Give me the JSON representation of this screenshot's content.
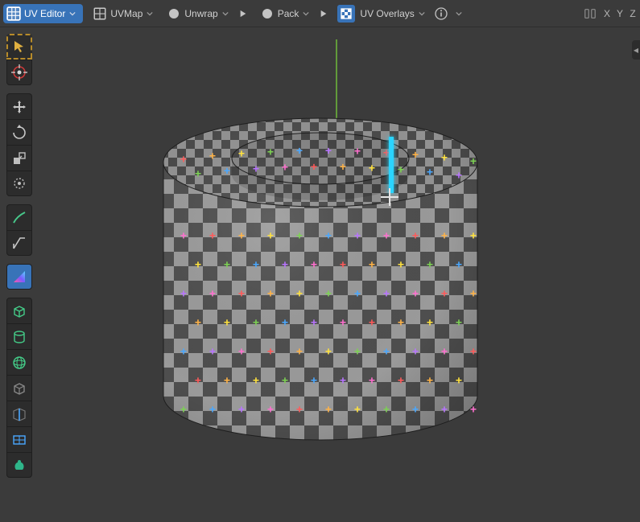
{
  "header": {
    "editor_label": "UV Editor",
    "uvmap_label": "UVMap",
    "unwrap_label": "Unwrap",
    "pack_label": "Pack",
    "overlays_label": "UV Overlays",
    "axis_x": "X",
    "axis_y": "Y",
    "axis_z": "Z"
  },
  "toolbar": {
    "tools": [
      "select-box",
      "cursor",
      "move",
      "rotate",
      "scale",
      "transform",
      "annotate",
      "measure",
      "uv-gradient",
      "uv-cube-project",
      "uv-cylinder-project",
      "uv-sphere-project",
      "uv-project-from-view",
      "uv-mark-seam",
      "uv-live-unwrap",
      "uv-island-scale"
    ]
  },
  "scene": {
    "object": "cylinder-with-checker-texture",
    "selected_edge": "vertical-seam",
    "seam_color": "#2ad4ff",
    "checker_colors": {
      "light": "#9a9a9a",
      "dark": "#4e4e4e"
    },
    "plus_colors": [
      "#ff5a5a",
      "#ffb347",
      "#ffe23d",
      "#7dd253",
      "#4aa8ff",
      "#b874ff",
      "#ff6fcf"
    ]
  }
}
